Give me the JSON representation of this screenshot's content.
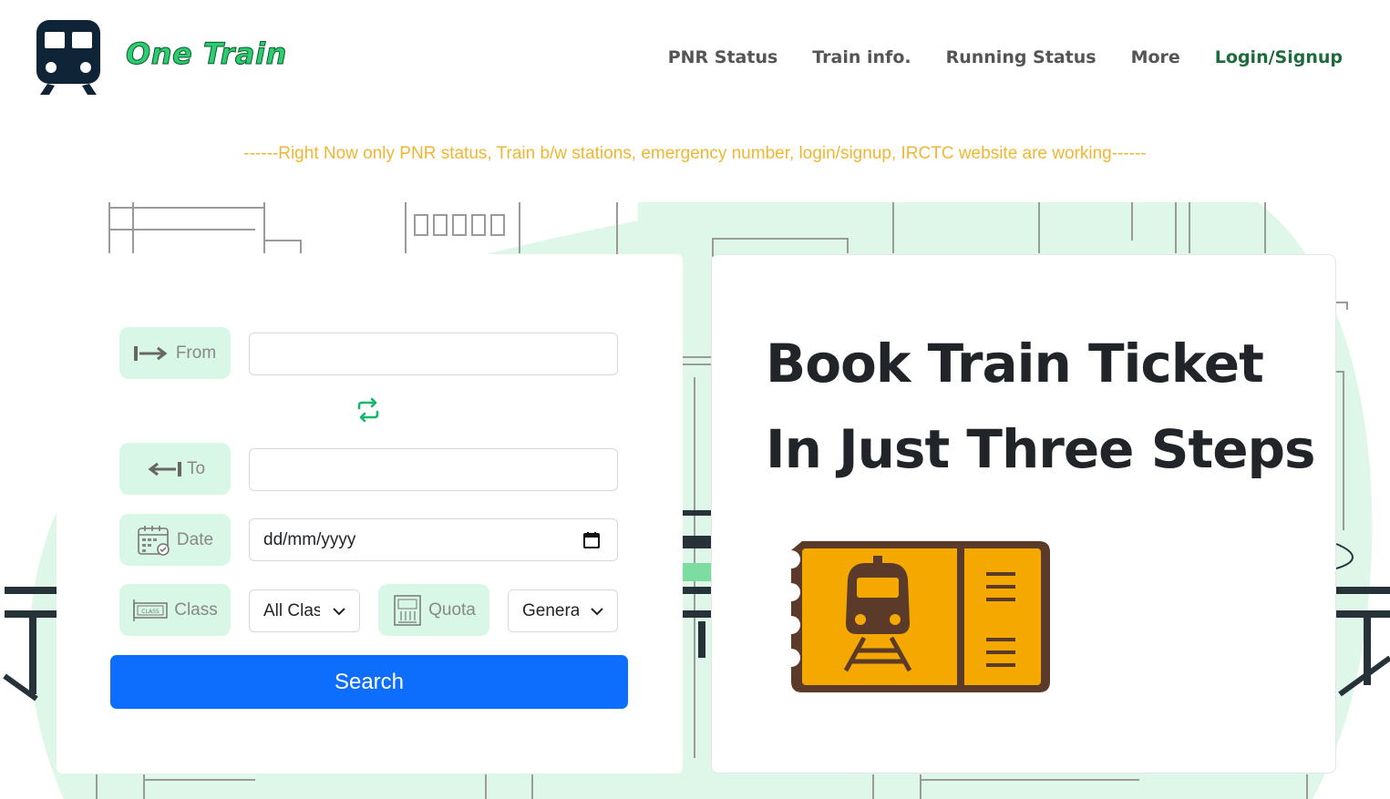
{
  "header": {
    "brand": "One Train",
    "nav": [
      {
        "label": "PNR Status"
      },
      {
        "label": "Train info."
      },
      {
        "label": "Running Status"
      },
      {
        "label": "More"
      },
      {
        "label": "Login/Signup"
      }
    ]
  },
  "notice": "------Right Now only PNR status, Train b/w stations, emergency number, login/signup, IRCTC website are working------",
  "form": {
    "from_label": "From",
    "from_value": "",
    "to_label": "To",
    "to_value": "",
    "date_label": "Date",
    "date_value": "dd/mm/yyyy",
    "class_label": "Class",
    "class_selected": "All Classes",
    "quota_label": "Quota",
    "quota_selected": "General",
    "search_label": "Search"
  },
  "hero": {
    "line1": "Book Train Ticket",
    "line2": "In Just Three Steps"
  },
  "colors": {
    "brand_green": "#2ecc71",
    "login_green": "#1d6b3c",
    "notice_yellow": "#f0b632",
    "pill_bg": "#d8f7e6",
    "primary_blue": "#0d6efd",
    "ticket_orange": "#f5a800",
    "ticket_brown": "#5b3a29"
  },
  "icons": {
    "logo": "train-front-icon",
    "from": "arrow-right-to-bar-icon",
    "to": "arrow-left-from-bar-icon",
    "date": "calendar-check-icon",
    "class": "class-ticket-icon",
    "quota": "quota-book-icon",
    "swap": "swap-arrows-icon",
    "ticket": "train-ticket-icon"
  }
}
